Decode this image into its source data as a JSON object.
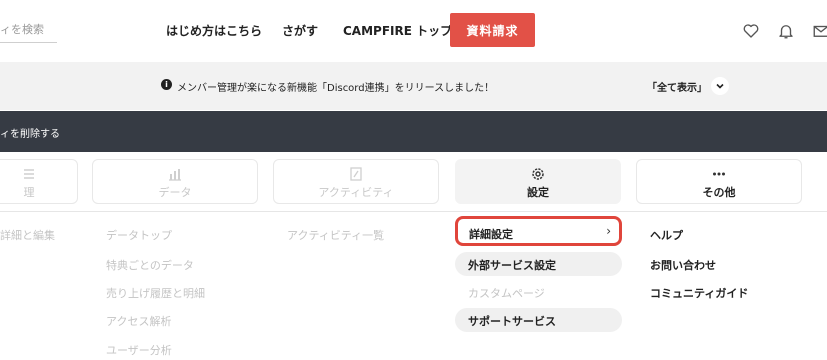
{
  "header": {
    "search_placeholder": "ィを検索",
    "nav": [
      "はじめ方はこちら",
      "さがす",
      "CAMPFIRE トップ"
    ],
    "cta_label": "資料請求"
  },
  "notice": {
    "text": "メンバー管理が楽になる新機能「Discord連携」をリリースしました！",
    "show_all": "「全て表示」"
  },
  "darkbar": {
    "text": "ィを削除する"
  },
  "tabs": [
    {
      "label": "理",
      "icon": "list-icon"
    },
    {
      "label": "データ",
      "icon": "bar-chart-icon"
    },
    {
      "label": "アクティビティ",
      "icon": "document-edit-icon"
    },
    {
      "label": "設定",
      "icon": "gear-icon"
    },
    {
      "label": "その他",
      "icon": "more-icon"
    }
  ],
  "menus": {
    "col0": [
      "詳細と編集"
    ],
    "col1": [
      "データトップ",
      "特典ごとのデータ",
      "売り上げ履歴と明細",
      "アクセス解析",
      "ユーザー分析"
    ],
    "col2": [
      "アクティビティ一覧"
    ],
    "settings": [
      "詳細設定",
      "外部サービス設定",
      "カスタムページ",
      "サポートサービス"
    ],
    "other": [
      "ヘルプ",
      "お問い合わせ",
      "コミュニティガイド"
    ]
  },
  "colors": {
    "accent": "#e25147",
    "highlight": "#e0453b",
    "darkbar": "#363b44"
  }
}
